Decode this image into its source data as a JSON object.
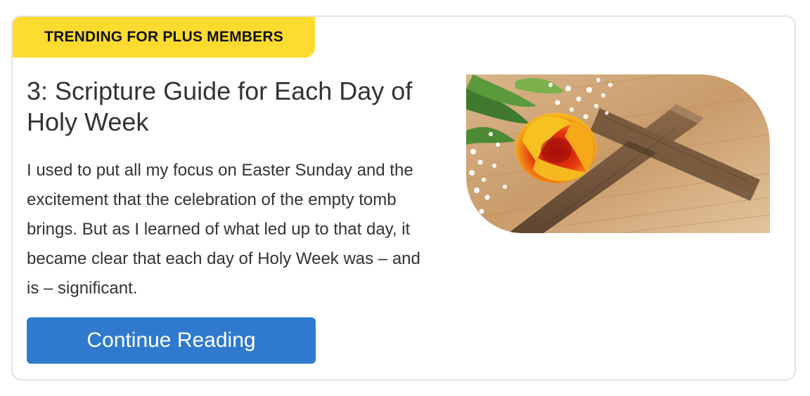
{
  "badge": {
    "label": "TRENDING FOR PLUS MEMBERS",
    "color": "#fedc2f"
  },
  "article": {
    "title": "3: Scripture Guide for Each Day of Holy Week",
    "excerpt": "I used to put all my focus on Easter Sunday and the excitement that the celebration of the empty tomb brings. But as I learned of what led up to that day, it became clear that each day of Holy Week was – and is – significant.",
    "cta_label": "Continue Reading",
    "cta_color": "#2f7ace"
  },
  "image": {
    "icon": "wooden-cross-with-tulip-photo"
  }
}
